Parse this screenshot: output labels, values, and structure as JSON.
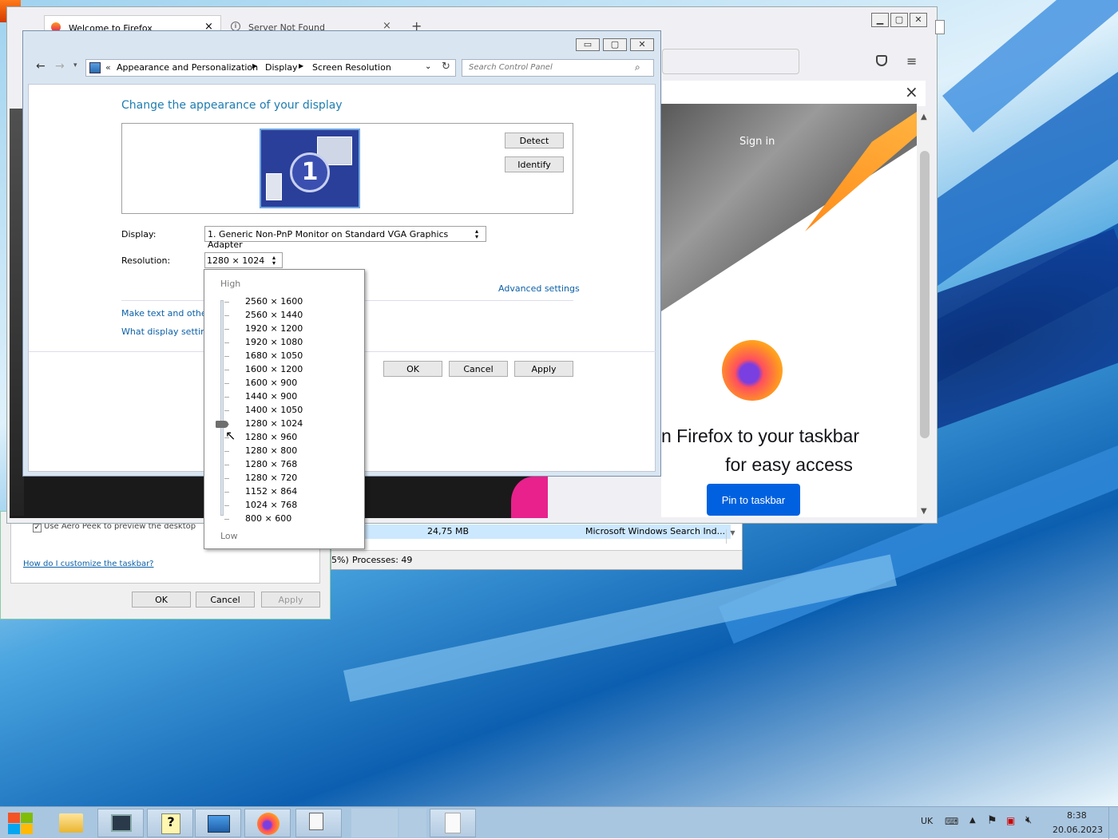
{
  "firefox": {
    "tabs": [
      {
        "label": "Welcome to Firefox"
      },
      {
        "label": "Server Not Found"
      }
    ],
    "new_tab_glyph": "+",
    "close_glyph": "×",
    "sign_in": "Sign in",
    "headline_line1": "n Firefox to your taskbar",
    "headline_line2": "for easy access",
    "pin_button": "Pin to taskbar"
  },
  "screen_resolution": {
    "breadcrumb": [
      "Appearance and Personalization",
      "Display",
      "Screen Resolution"
    ],
    "breadcrumb_prefix": "«",
    "search_placeholder": "Search Control Panel",
    "heading": "Change the appearance of your display",
    "monitor_number": "1",
    "detect_button": "Detect",
    "identify_button": "Identify",
    "display_label": "Display:",
    "display_value": "1. Generic Non-PnP Monitor on Standard VGA Graphics Adapter",
    "resolution_label": "Resolution:",
    "resolution_value": "1280 × 1024",
    "advanced_settings": "Advanced settings",
    "link_text_size": "Make text and other",
    "link_display_settings": "What display setting",
    "ok_button": "OK",
    "cancel_button": "Cancel",
    "apply_button": "Apply"
  },
  "resolution_dropdown": {
    "high_label": "High",
    "low_label": "Low",
    "options": [
      "2560 × 1600",
      "2560 × 1440",
      "1920 × 1200",
      "1920 × 1080",
      "1680 × 1050",
      "1600 × 1200",
      "1600 × 900",
      "1440 × 900",
      "1400 × 1050",
      "1280 × 1024",
      "1280 × 960",
      "1280 × 800",
      "1280 × 768",
      "1280 × 720",
      "1152 × 864",
      "1024 × 768",
      "800 × 600"
    ],
    "selected_index": 9
  },
  "taskbar_props": {
    "aero_peek": "Use Aero Peek to preview the desktop",
    "help_link": "How do I customize the taskbar?",
    "ok_button": "OK",
    "cancel_button": "Cancel",
    "apply_button": "Apply"
  },
  "task_manager": {
    "memory": "24,75 MB",
    "description": "Microsoft Windows Search Ind...",
    "cpu_fragment": "5%)",
    "processes": "Processes: 49"
  },
  "system_tray": {
    "language": "UK",
    "time": "8:38",
    "date": "20.06.2023"
  },
  "colors": {
    "accent_blue": "#0b6fc9",
    "heading_teal": "#1e7db0",
    "firefox_orange": "#ff8c1a"
  }
}
